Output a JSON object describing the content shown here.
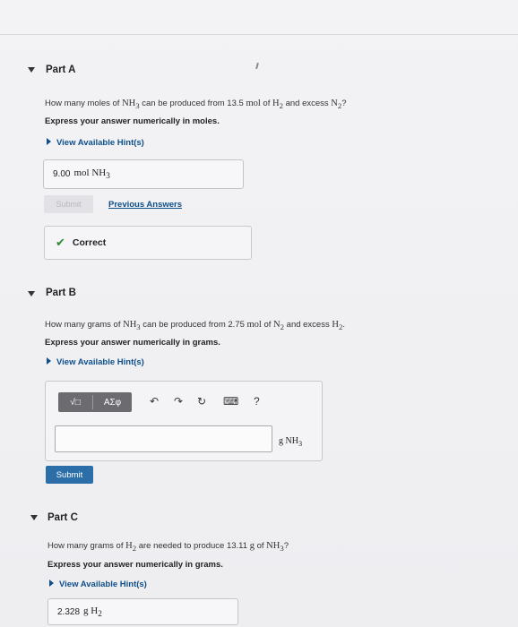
{
  "partA": {
    "label": "Part A",
    "question_pre": "How many moles of ",
    "question_sub1": "NH",
    "question_sub1_n": "3",
    "question_mid": " can be produced from 13.5 ",
    "question_unit": "mol",
    "question_of": " of ",
    "question_h2": "H",
    "question_h2_n": "2",
    "question_and": " and excess ",
    "question_n2": "N",
    "question_n2_n": "2",
    "question_end": "?",
    "instruction": "Express your answer numerically in moles.",
    "hint": "View Available Hint(s)",
    "answer_value": "9.00",
    "answer_unit": "mol NH",
    "answer_unit_n": "3",
    "submit_label": "Submit",
    "previous_label": "Previous Answers",
    "correct_label": "Correct"
  },
  "partB": {
    "label": "Part B",
    "question_pre": "How many grams of ",
    "question_nh": "NH",
    "question_nh_n": "3",
    "question_mid": " can be produced from 2.75 ",
    "question_unit": "mol",
    "question_of": " of ",
    "question_n2": "N",
    "question_n2_n": "2",
    "question_and": " and excess ",
    "question_h2": "H",
    "question_h2_n": "2",
    "question_end": ".",
    "instruction": "Express your answer numerically in grams.",
    "hint": "View Available Hint(s)",
    "tool_template": "√□",
    "tool_greek": "AΣφ",
    "tool_undo": "↶",
    "tool_redo": "↷",
    "tool_reset": "↻",
    "tool_keyboard": "⌨",
    "tool_help": "?",
    "unit_label": "g NH",
    "unit_label_n": "3",
    "submit_label": "Submit"
  },
  "partC": {
    "label": "Part C",
    "question_pre": "How many grams of ",
    "question_h2": "H",
    "question_h2_n": "2",
    "question_mid": " are needed to produce 13.11 ",
    "question_unit": "g",
    "question_of": " of ",
    "question_nh": "NH",
    "question_nh_n": "3",
    "question_end": "?",
    "instruction": "Express your answer numerically in grams.",
    "hint": "View Available Hint(s)",
    "answer_value": "2.328",
    "answer_unit": "g H",
    "answer_unit_n": "2"
  }
}
